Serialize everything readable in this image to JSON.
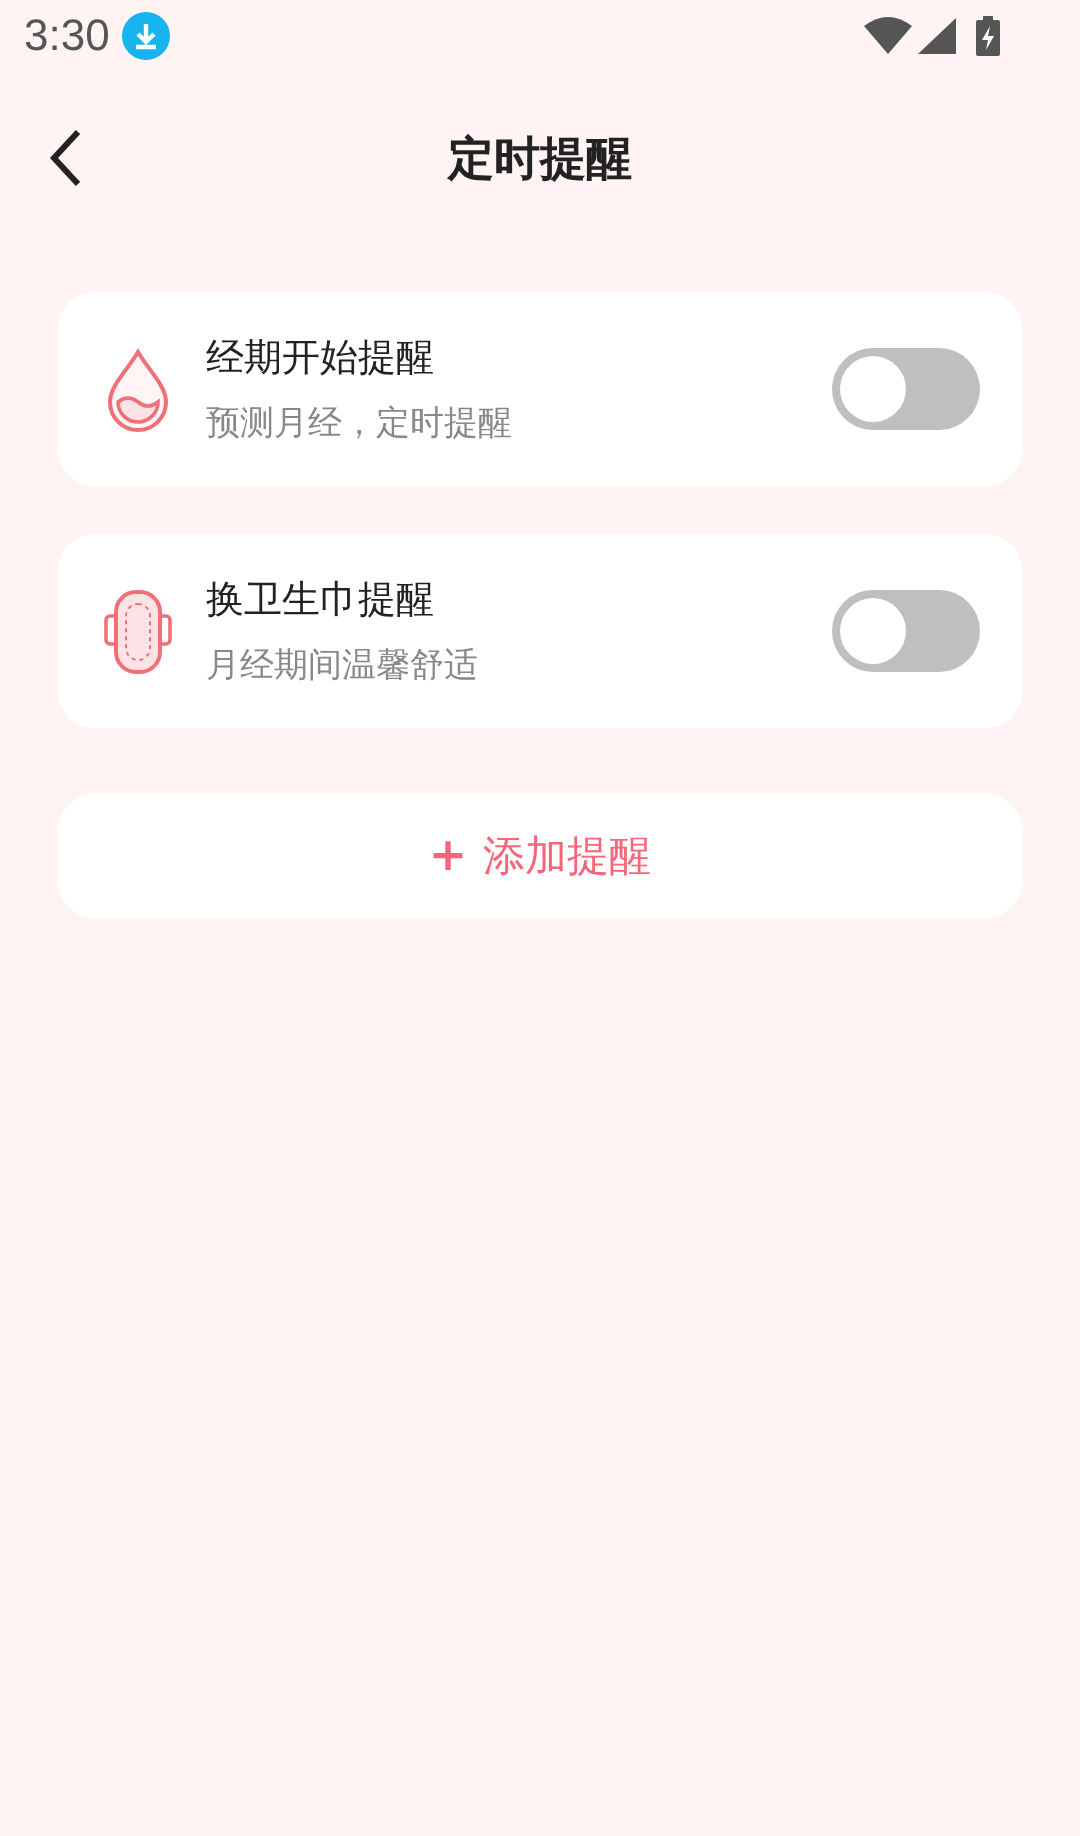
{
  "status_bar": {
    "time": "3:30"
  },
  "header": {
    "title": "定时提醒"
  },
  "reminders": [
    {
      "title": "经期开始提醒",
      "subtitle": "预测月经，定时提醒",
      "on": false
    },
    {
      "title": "换卫生巾提醒",
      "subtitle": "月经期间温馨舒适",
      "on": false
    }
  ],
  "add_button": {
    "icon": "+",
    "label": "添加提醒"
  }
}
